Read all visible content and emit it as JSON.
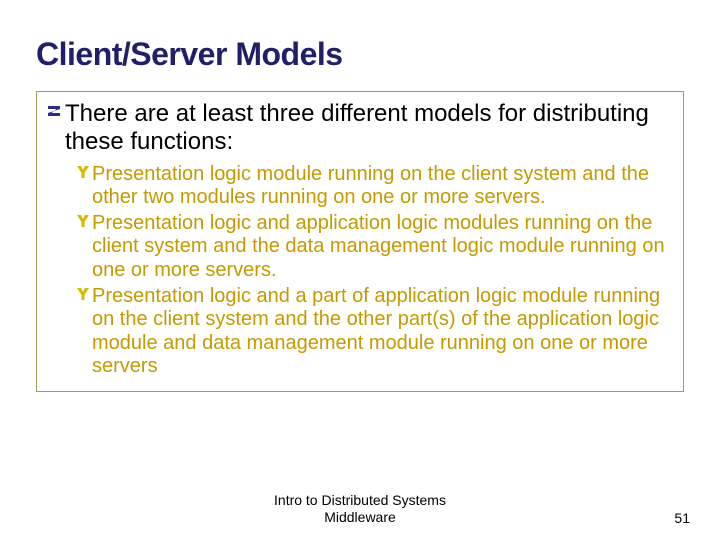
{
  "title": "Client/Server Models",
  "main_bullet": "There are at least three different models for distributing these functions:",
  "sub_bullets": [
    "Presentation logic module running on the client system and the other two modules running on one or more servers.",
    "Presentation logic and application logic modules running on the client system and the data management logic module running on one or more servers.",
    "Presentation logic and a part of application logic module running on the client system and the other part(s) of the application logic module and data management module running on one or more servers"
  ],
  "footer_line1": "Intro to Distributed Systems",
  "footer_line2": "Middleware",
  "page_number": "51"
}
